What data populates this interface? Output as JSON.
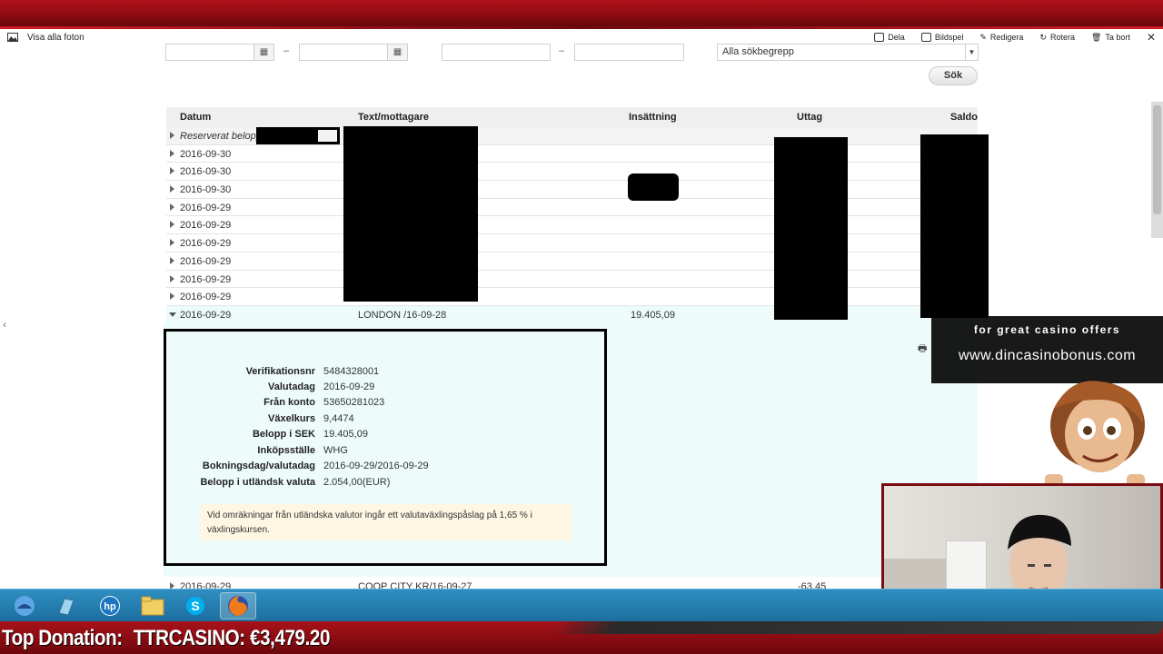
{
  "viewer": {
    "back_label": "Visa alla foton",
    "actions": [
      {
        "label": "Dela",
        "icon": "share-icon"
      },
      {
        "label": "Bildspel",
        "icon": "slideshow-icon"
      },
      {
        "label": "Redigera",
        "icon": "edit-icon"
      },
      {
        "label": "Rotera",
        "icon": "rotate-icon"
      },
      {
        "label": "Ta bort",
        "icon": "trash-icon"
      }
    ],
    "close_glyph": "✕"
  },
  "filters": {
    "dash": "–",
    "search_term_value": "Alla sökbegrepp",
    "search_button": "Sök"
  },
  "table": {
    "headers": {
      "date": "Datum",
      "text": "Text/mottagare",
      "deposit": "Insättning",
      "withdrawal": "Uttag",
      "balance": "Saldo"
    },
    "reserved_label": "Reserverat belopp",
    "rows": [
      {
        "date": "2016-09-30"
      },
      {
        "date": "2016-09-30"
      },
      {
        "date": "2016-09-30"
      },
      {
        "date": "2016-09-29"
      },
      {
        "date": "2016-09-29"
      },
      {
        "date": "2016-09-29"
      },
      {
        "date": "2016-09-29"
      },
      {
        "date": "2016-09-29"
      },
      {
        "date": "2016-09-29"
      }
    ],
    "expanded_row": {
      "date": "2016-09-29",
      "text": "LONDON /16-09-28",
      "deposit": "19.405,09"
    },
    "next_row": {
      "date": "2016-09-29",
      "text": "COOP CITY KR/16-09-27",
      "withdrawal": "-63,45"
    }
  },
  "detail": {
    "fields": [
      {
        "key": "Verifikationsnr",
        "value": "5484328001"
      },
      {
        "key": "Valutadag",
        "value": "2016-09-29"
      },
      {
        "key": "Från konto",
        "value": "53650281023"
      },
      {
        "key": "Växelkurs",
        "value": "9,4474"
      },
      {
        "key": "Belopp i SEK",
        "value": "19.405,09"
      },
      {
        "key": "Inköpsställe",
        "value": "WHG"
      },
      {
        "key": "Bokningsdag/valutadag",
        "value": "2016-09-29/2016-09-29"
      },
      {
        "key": "Belopp i utländsk valuta",
        "value": "2.054,00(EUR)"
      }
    ],
    "note": "Vid omräkningar från utländska valutor ingår ett valutaväxlingspåslag på 1,65 % i växlingskursen."
  },
  "overlay": {
    "casino_line1": "for great casino offers",
    "casino_line2": "www.dincasinobonus.com",
    "donation_label": "Top Donation:",
    "donation_value": "TTRCASINO: €3,479.20"
  },
  "taskbar": {
    "apps": [
      "thunderbird-icon",
      "notepad-icon",
      "hp-icon",
      "file-explorer-icon",
      "skype-icon",
      "firefox-icon"
    ],
    "skype_glyph": "S",
    "hp_glyph": "hp"
  },
  "colors": {
    "stream_red": "#8a0b12",
    "taskbar_blue": "#1c6f9f",
    "detail_bg": "#eefbfb",
    "note_bg": "#fdf6e3"
  }
}
